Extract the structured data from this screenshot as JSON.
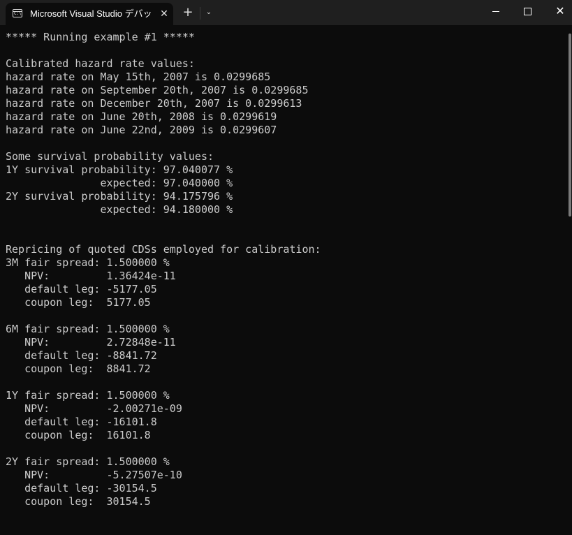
{
  "window": {
    "tab_title": "Microsoft Visual Studio デバッグ",
    "tab_icon_text": "C:\\",
    "icons": {
      "tab": "terminal-icon",
      "close_tab": "close-icon",
      "new_tab": "plus-icon",
      "dropdown": "chevron-down-icon",
      "minimize": "minimize-icon",
      "maximize": "maximize-icon",
      "close_window": "close-icon"
    },
    "glyphs": {
      "close_tab": "✕",
      "new_tab": "+",
      "dropdown": "⌄",
      "close_window": "✕"
    }
  },
  "console": {
    "lines": [
      "***** Running example #1 *****",
      "",
      "Calibrated hazard rate values:",
      "hazard rate on May 15th, 2007 is 0.0299685",
      "hazard rate on September 20th, 2007 is 0.0299685",
      "hazard rate on December 20th, 2007 is 0.0299613",
      "hazard rate on June 20th, 2008 is 0.0299619",
      "hazard rate on June 22nd, 2009 is 0.0299607",
      "",
      "Some survival probability values:",
      "1Y survival probability: 97.040077 %",
      "               expected: 97.040000 %",
      "2Y survival probability: 94.175796 %",
      "               expected: 94.180000 %",
      "",
      "",
      "Repricing of quoted CDSs employed for calibration:",
      "3M fair spread: 1.500000 %",
      "   NPV:         1.36424e-11",
      "   default leg: -5177.05",
      "   coupon leg:  5177.05",
      "",
      "6M fair spread: 1.500000 %",
      "   NPV:         2.72848e-11",
      "   default leg: -8841.72",
      "   coupon leg:  8841.72",
      "",
      "1Y fair spread: 1.500000 %",
      "   NPV:         -2.00271e-09",
      "   default leg: -16101.8",
      "   coupon leg:  16101.8",
      "",
      "2Y fair spread: 1.500000 %",
      "   NPV:         -5.27507e-10",
      "   default leg: -30154.5",
      "   coupon leg:  30154.5"
    ]
  }
}
